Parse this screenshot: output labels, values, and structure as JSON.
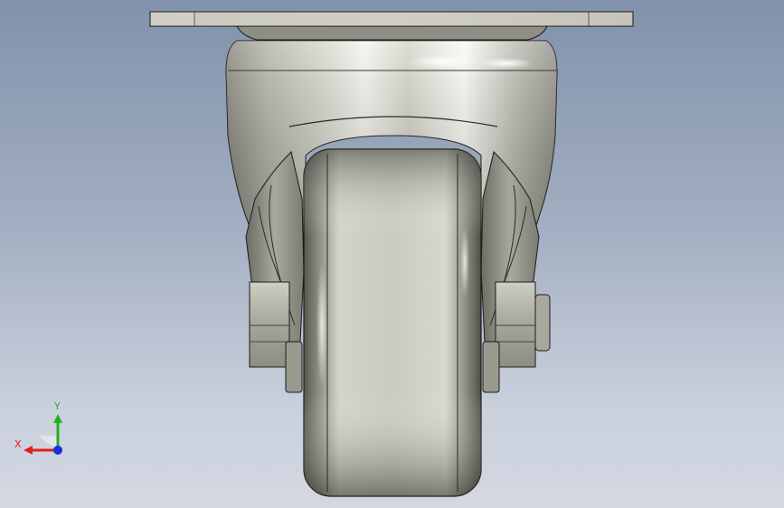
{
  "viewport": {
    "background_top": "#8292ab",
    "background_bottom": "#d3d8e2"
  },
  "model": {
    "metal_color": "#c9c8bd",
    "wheel_color": "#c7c7bd",
    "outline_color": "#1a1a1a"
  },
  "triad": {
    "x_label": "X",
    "y_label": "Y",
    "x_color": "#e0201c",
    "y_color": "#22b022",
    "z_color": "#1a2ee0"
  }
}
